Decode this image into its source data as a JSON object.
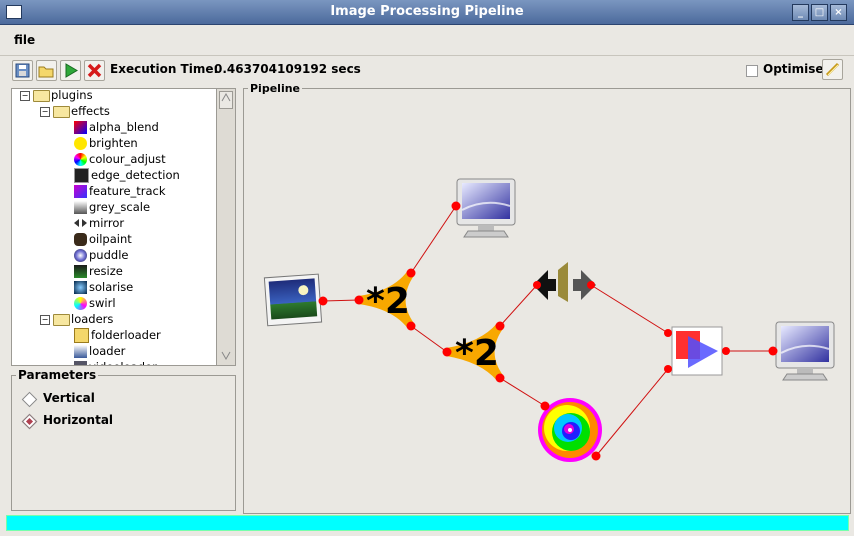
{
  "window": {
    "title": "Image Processing Pipeline"
  },
  "menu": {
    "file": "file"
  },
  "toolbar": {
    "exec_label": "Execution Time:",
    "exec_value": "0.463704109192 secs",
    "optimise": "Optimise"
  },
  "tree": {
    "root": "plugins",
    "effects_folder": "effects",
    "effects": [
      "alpha_blend",
      "brighten",
      "colour_adjust",
      "edge_detection",
      "feature_track",
      "grey_scale",
      "mirror",
      "oilpaint",
      "puddle",
      "resize",
      "solarise",
      "swirl"
    ],
    "loaders_folder": "loaders",
    "loaders": [
      "folderloader",
      "loader",
      "videoloader"
    ]
  },
  "parameters": {
    "title": "Parameters",
    "options": [
      "Vertical",
      "Horizontal"
    ],
    "selected": "Horizontal"
  },
  "pipeline": {
    "title": "Pipeline",
    "resize_label_1": "*2",
    "resize_label_2": "*2"
  },
  "colors": {
    "status_bar": "#00ffff",
    "node_dot": "#ff0000",
    "edge": "#d01010",
    "resize_node": "#f8a800"
  }
}
